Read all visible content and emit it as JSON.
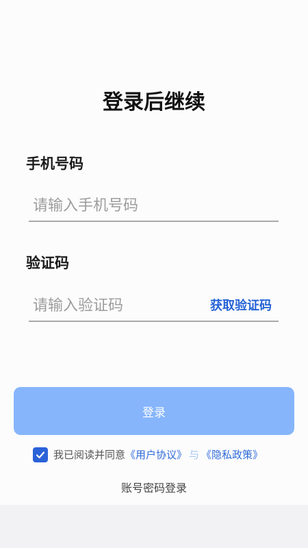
{
  "page": {
    "title": "登录后继续"
  },
  "phone": {
    "label": "手机号码",
    "placeholder": "请输入手机号码",
    "value": ""
  },
  "code": {
    "label": "验证码",
    "placeholder": "请输入验证码",
    "value": "",
    "get_code_label": "获取验证码"
  },
  "login": {
    "button_label": "登录"
  },
  "agreement": {
    "checked": true,
    "prefix": "我已阅读并同意",
    "user_agreement": "《用户协议》",
    "conjunction": "与",
    "privacy_policy": "《隐私政策》"
  },
  "alt_login": {
    "label": "账号密码登录"
  },
  "colors": {
    "accent": "#2a62d8",
    "button_bg": "#86b5fc",
    "link": "#2f6bd8"
  }
}
